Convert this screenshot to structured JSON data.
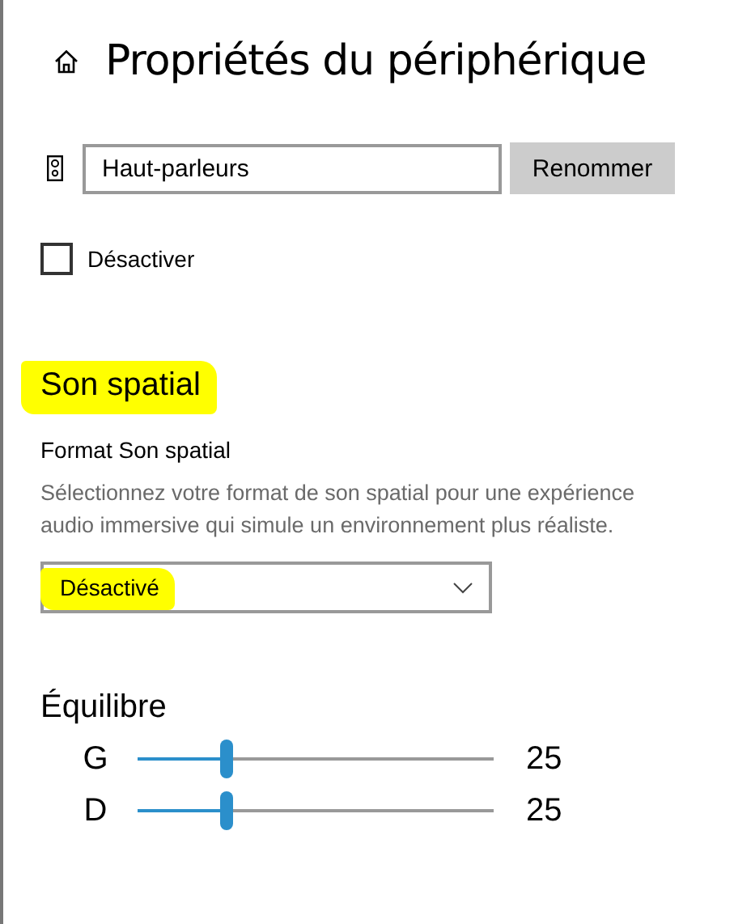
{
  "title": "Propriétés du périphérique",
  "device": {
    "name": "Haut-parleurs",
    "rename_button": "Renommer"
  },
  "disable": {
    "label": "Désactiver",
    "checked": false
  },
  "spatial_sound": {
    "heading": "Son spatial",
    "highlighted": true,
    "format_label": "Format Son spatial",
    "description": "Sélectionnez votre format de son spatial pour une expérience audio immersive qui simule un environnement plus réaliste.",
    "dropdown": {
      "value": "Désactivé",
      "highlighted": true
    }
  },
  "balance": {
    "heading": "Équilibre",
    "channels": [
      {
        "name": "G",
        "level": 0.25,
        "reading": "25"
      },
      {
        "name": "D",
        "level": 0.25,
        "reading": "25"
      }
    ]
  }
}
